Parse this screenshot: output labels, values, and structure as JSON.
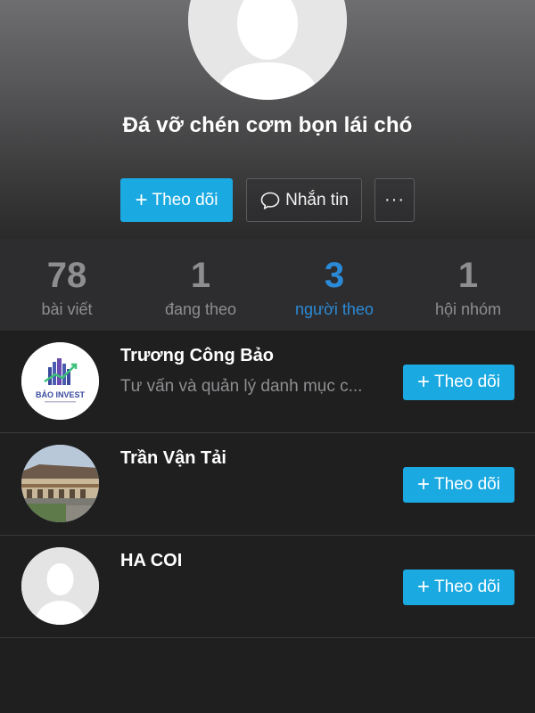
{
  "profile": {
    "name": "Đá vỡ chén cơm bọn lái chó",
    "avatar_icon": "default-user-avatar"
  },
  "actions": {
    "follow_plus": "+",
    "follow_label": "Theo dõi",
    "message_icon": "speech-bubble-icon",
    "message_label": "Nhắn tin",
    "more_label": "···"
  },
  "stats": [
    {
      "value": "78",
      "label": "bài viết",
      "active": false
    },
    {
      "value": "1",
      "label": "đang theo",
      "active": false
    },
    {
      "value": "3",
      "label": "người theo",
      "active": true
    },
    {
      "value": "1",
      "label": "hội nhóm",
      "active": false
    }
  ],
  "followers": [
    {
      "name": "Trương Công Bảo",
      "description": "Tư vấn và quản lý danh mục c...",
      "avatar": "bao-invest-logo",
      "avatar_text": "BẢO INVEST",
      "follow_plus": "+",
      "follow_label": "Theo dõi"
    },
    {
      "name": "Trần Vận Tải",
      "description": "",
      "avatar": "building-photo",
      "follow_plus": "+",
      "follow_label": "Theo dõi"
    },
    {
      "name": "HA COI",
      "description": "",
      "avatar": "default-user-avatar",
      "follow_plus": "+",
      "follow_label": "Theo dõi"
    }
  ],
  "colors": {
    "accent": "#1ba9e1",
    "active_stat": "#2b8ad7",
    "muted_text": "#8e8e90",
    "background": "#1f1f20"
  }
}
